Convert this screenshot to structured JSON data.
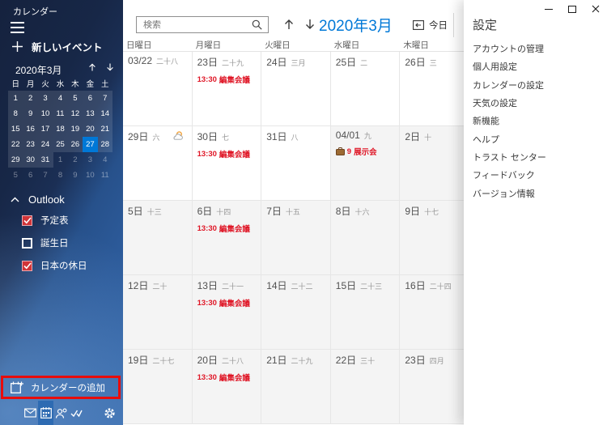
{
  "window": {
    "app_name": "カレンダー"
  },
  "sidebar": {
    "app_title": "カレンダー",
    "new_event": "新しいイベント",
    "mini_calendar": {
      "title": "2020年3月",
      "weekdays": [
        "日",
        "月",
        "火",
        "水",
        "木",
        "金",
        "土"
      ],
      "selected_day": 27,
      "days": [
        {
          "d": 1,
          "cur": true
        },
        {
          "d": 2,
          "cur": true
        },
        {
          "d": 3,
          "cur": true
        },
        {
          "d": 4,
          "cur": true
        },
        {
          "d": 5,
          "cur": true
        },
        {
          "d": 6,
          "cur": true
        },
        {
          "d": 7,
          "cur": true
        },
        {
          "d": 8,
          "cur": true
        },
        {
          "d": 9,
          "cur": true
        },
        {
          "d": 10,
          "cur": true
        },
        {
          "d": 11,
          "cur": true
        },
        {
          "d": 12,
          "cur": true
        },
        {
          "d": 13,
          "cur": true
        },
        {
          "d": 14,
          "cur": true
        },
        {
          "d": 15,
          "cur": true
        },
        {
          "d": 16,
          "cur": true
        },
        {
          "d": 17,
          "cur": true
        },
        {
          "d": 18,
          "cur": true
        },
        {
          "d": 19,
          "cur": true
        },
        {
          "d": 20,
          "cur": true
        },
        {
          "d": 21,
          "cur": true
        },
        {
          "d": 22,
          "cur": true
        },
        {
          "d": 23,
          "cur": true
        },
        {
          "d": 24,
          "cur": true
        },
        {
          "d": 25,
          "cur": true
        },
        {
          "d": 26,
          "cur": true
        },
        {
          "d": 27,
          "cur": true,
          "sel": true
        },
        {
          "d": 28,
          "cur": true
        },
        {
          "d": 29,
          "cur": true
        },
        {
          "d": 30,
          "cur": true
        },
        {
          "d": 31,
          "cur": true
        },
        {
          "d": 1,
          "cur": false
        },
        {
          "d": 2,
          "cur": false
        },
        {
          "d": 3,
          "cur": false
        },
        {
          "d": 4,
          "cur": false
        },
        {
          "d": 5,
          "cur": false
        },
        {
          "d": 6,
          "cur": false
        },
        {
          "d": 7,
          "cur": false
        },
        {
          "d": 8,
          "cur": false
        },
        {
          "d": 9,
          "cur": false
        },
        {
          "d": 10,
          "cur": false
        },
        {
          "d": 11,
          "cur": false
        }
      ]
    },
    "group": {
      "label": "Outlook",
      "items": [
        {
          "label": "予定表",
          "checked": true
        },
        {
          "label": "誕生日",
          "checked": false
        },
        {
          "label": "日本の休日",
          "checked": true
        }
      ]
    },
    "add_calendar": "カレンダーの追加",
    "nav_icons": [
      "mail",
      "calendar",
      "people",
      "todo",
      "settings"
    ],
    "nav_active": "calendar"
  },
  "toolbar": {
    "search_placeholder": "検索",
    "month_title": "2020年3月",
    "today": "今日"
  },
  "grid": {
    "day_headers": [
      "日曜日",
      "月曜日",
      "火曜日",
      "水曜日",
      "木曜日"
    ],
    "weeks": [
      [
        {
          "date": "03/22",
          "lunar": "二十八"
        },
        {
          "date": "23日",
          "lunar": "二十九",
          "event": {
            "time": "13:30",
            "title": "編集会議"
          }
        },
        {
          "date": "24日",
          "lunar": "三月"
        },
        {
          "date": "25日",
          "lunar": "二"
        },
        {
          "date": "26日",
          "lunar": "三"
        }
      ],
      [
        {
          "date": "29日",
          "lunar": "六",
          "weather": true
        },
        {
          "date": "30日",
          "lunar": "七",
          "event": {
            "time": "13:30",
            "title": "編集会議"
          }
        },
        {
          "date": "31日",
          "lunar": "八"
        },
        {
          "date": "04/01",
          "lunar": "九",
          "apr": true,
          "allday": {
            "badge": "9",
            "title": "展示会"
          }
        },
        {
          "date": "2日",
          "lunar": "十",
          "apr": true
        }
      ],
      [
        {
          "date": "5日",
          "lunar": "十三",
          "apr": true
        },
        {
          "date": "6日",
          "lunar": "十四",
          "apr": true,
          "event": {
            "time": "13:30",
            "title": "編集会議"
          }
        },
        {
          "date": "7日",
          "lunar": "十五",
          "apr": true
        },
        {
          "date": "8日",
          "lunar": "十六",
          "apr": true
        },
        {
          "date": "9日",
          "lunar": "十七",
          "apr": true
        }
      ],
      [
        {
          "date": "12日",
          "lunar": "二十",
          "apr": true
        },
        {
          "date": "13日",
          "lunar": "二十一",
          "apr": true,
          "event": {
            "time": "13:30",
            "title": "編集会議"
          }
        },
        {
          "date": "14日",
          "lunar": "二十二",
          "apr": true
        },
        {
          "date": "15日",
          "lunar": "二十三",
          "apr": true
        },
        {
          "date": "16日",
          "lunar": "二十四",
          "apr": true
        }
      ],
      [
        {
          "date": "19日",
          "lunar": "二十七",
          "apr": true
        },
        {
          "date": "20日",
          "lunar": "二十八",
          "apr": true,
          "event": {
            "time": "13:30",
            "title": "編集会議"
          }
        },
        {
          "date": "21日",
          "lunar": "二十九",
          "apr": true
        },
        {
          "date": "22日",
          "lunar": "三十",
          "apr": true
        },
        {
          "date": "23日",
          "lunar": "四月",
          "apr": true
        }
      ]
    ]
  },
  "settings": {
    "title": "設定",
    "items": [
      "アカウントの管理",
      "個人用設定",
      "カレンダーの設定",
      "天気の設定",
      "新機能",
      "ヘルプ",
      "トラスト センター",
      "フィードバック",
      "バージョン情報"
    ]
  },
  "colors": {
    "accent": "#0078d7",
    "event_red": "#df1525",
    "calendar_checkbox_red": "#d13438",
    "annotation_red": "#e80c0c",
    "active_nav_blue": "#2e6bb2"
  }
}
